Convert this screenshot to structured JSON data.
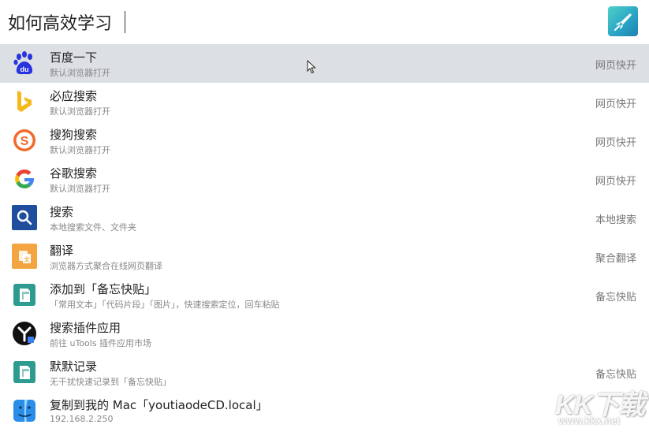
{
  "search": {
    "query": "如何高效学习"
  },
  "colors": {
    "selected_row": "#dcdfe3",
    "baidu_blue": "#2932e1",
    "bing": "#f5b81c",
    "sogou": "#f26a2a",
    "search_blue": "#1f4f9c",
    "translate_orange": "#f3a541",
    "clipboard_teal": "#2d9b8f",
    "black": "#111111",
    "finder_blue": "#2a8ee8"
  },
  "results": [
    {
      "icon": "baidu-icon",
      "title": "百度一下",
      "subtitle": "默认浏览器打开",
      "right": "网页快开"
    },
    {
      "icon": "bing-icon",
      "title": "必应搜索",
      "subtitle": "默认浏览器打开",
      "right": "网页快开"
    },
    {
      "icon": "sogou-icon",
      "title": "搜狗搜索",
      "subtitle": "默认浏览器打开",
      "right": "网页快开"
    },
    {
      "icon": "google-icon",
      "title": "谷歌搜索",
      "subtitle": "默认浏览器打开",
      "right": "网页快开"
    },
    {
      "icon": "magnifier-icon",
      "title": "搜索",
      "subtitle": "本地搜索文件、文件夹",
      "right": "本地搜索"
    },
    {
      "icon": "translate-icon",
      "title": "翻译",
      "subtitle": "浏览器方式聚合在线网页翻译",
      "right": "聚合翻译"
    },
    {
      "icon": "clipboard-icon",
      "title": "添加到「备忘快贴」",
      "subtitle": "「常用文本」「代码片段」「图片」，快速搜索定位，回车粘贴",
      "right": "备忘快贴"
    },
    {
      "icon": "utools-plugin-icon",
      "title": "搜索插件应用",
      "subtitle": "前往 uTools 插件应用市场",
      "right": ""
    },
    {
      "icon": "clipboard-icon",
      "title": "默默记录",
      "subtitle": "无干扰快速记录到「备忘快贴」",
      "right": "备忘快贴"
    },
    {
      "icon": "finder-icon",
      "title": "复制到我的 Mac「youtiaodeCD.local」",
      "subtitle": "192.168.2.250",
      "right": ""
    }
  ],
  "watermark": {
    "text": "KK下载",
    "url": "www.kkx.net"
  }
}
